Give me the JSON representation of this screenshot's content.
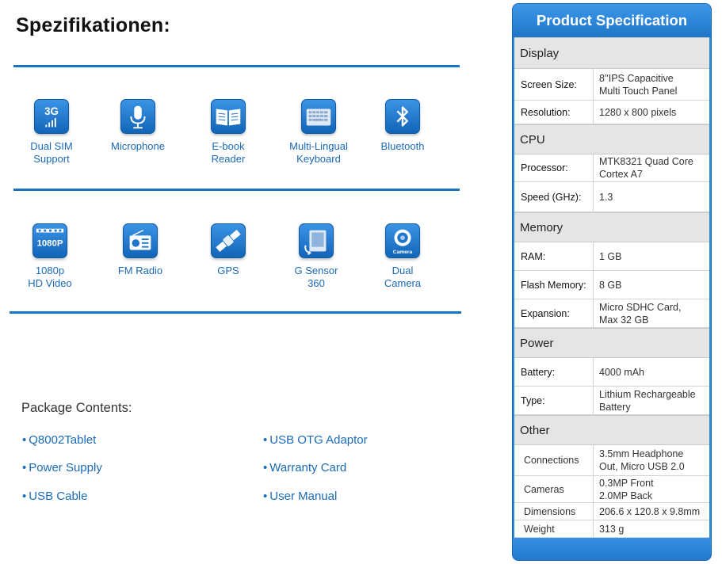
{
  "page_title": "Spezifikationen:",
  "features_row1": [
    {
      "icon": "3g-signal-icon",
      "label": "Dual SIM\nSupport"
    },
    {
      "icon": "microphone-icon",
      "label": "Microphone"
    },
    {
      "icon": "book-icon",
      "label": "E-book\nReader"
    },
    {
      "icon": "keyboard-icon",
      "label": "Multi-Lingual\nKeyboard"
    },
    {
      "icon": "bluetooth-icon",
      "label": "Bluetooth"
    }
  ],
  "features_row2": [
    {
      "icon": "hd-video-icon",
      "label": "1080p\nHD Video",
      "badge": "1080P"
    },
    {
      "icon": "radio-icon",
      "label": "FM Radio"
    },
    {
      "icon": "gps-satellite-icon",
      "label": "GPS"
    },
    {
      "icon": "g-sensor-icon",
      "label": "G Sensor\n360"
    },
    {
      "icon": "camera-icon",
      "label": "Dual\nCamera",
      "badge": "Camera"
    }
  ],
  "icon_badges": {
    "signal": "3G"
  },
  "package": {
    "title": "Package Contents:",
    "items": [
      "Q8002Tablet",
      "Power Supply",
      "USB Cable",
      "USB OTG Adaptor",
      "Warranty Card",
      "User Manual"
    ]
  },
  "spec": {
    "title": "Product Specification",
    "sections": [
      {
        "name": "Display",
        "rows": [
          {
            "key": "Screen Size:",
            "value": "8''IPS Capacitive\nMulti Touch Panel"
          },
          {
            "key": "Resolution:",
            "value": "1280 x 800 pixels"
          }
        ]
      },
      {
        "name": "CPU",
        "rows": [
          {
            "key": "Processor:",
            "value": "MTK8321 Quad Core\nCortex A7"
          },
          {
            "key": "Speed (GHz):",
            "value": "1.3"
          }
        ]
      },
      {
        "name": "Memory",
        "rows": [
          {
            "key": "RAM:",
            "value": "1 GB"
          },
          {
            "key": "Flash Memory:",
            "value": "8 GB"
          },
          {
            "key": "Expansion:",
            "value": "Micro SDHC Card,\nMax 32 GB"
          }
        ]
      },
      {
        "name": "Power",
        "rows": [
          {
            "key": "Battery:",
            "value": "4000 mAh"
          },
          {
            "key": "Type:",
            "value": "Lithium Rechargeable\nBattery"
          }
        ]
      },
      {
        "name": "Other",
        "rows": [
          {
            "key": "Connections",
            "value": "3.5mm Headphone\nOut, Micro USB 2.0"
          },
          {
            "key": "Cameras",
            "value": "0.3MP Front\n2.0MP Back"
          },
          {
            "key": "Dimensions",
            "value": "206.6 x 120.8 x 9.8mm"
          },
          {
            "key": "Weight",
            "value": "313 g"
          }
        ]
      }
    ]
  },
  "colors": {
    "accent": "#1b73c4",
    "label_blue": "#1a6ab8",
    "section_gray": "#e5e5e5"
  }
}
